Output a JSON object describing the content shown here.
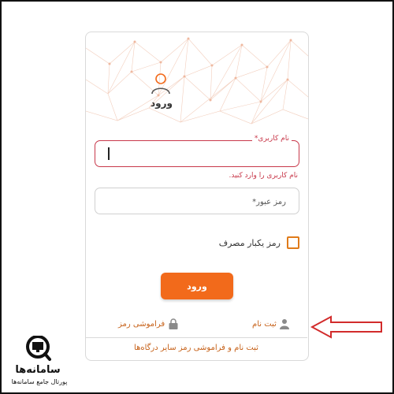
{
  "form": {
    "title": "ورود",
    "username": {
      "label": "نام کاربری",
      "required_mark": "*",
      "value": "",
      "error": "نام کاربری را وارد کنید."
    },
    "password": {
      "placeholder": "رمز عبور",
      "required_mark": "*"
    },
    "otp_checkbox": {
      "label": "رمز یکبار مصرف",
      "checked": false
    },
    "login_button": "ورود",
    "forgot_password": "فراموشی رمز",
    "register": "ثبت نام",
    "other_gateways_link": "ثبت نام و فراموشی رمز سایر درگاه‌ها"
  },
  "branding": {
    "name": "سامانه‌ها",
    "tagline": "پورتال جامع سامانه‌ها"
  },
  "colors": {
    "accent": "#f26a1b",
    "error": "#c8384a",
    "link": "#c7621a",
    "annotation_arrow": "#d22b2b"
  },
  "icons": [
    "user-icon",
    "lock-icon",
    "person-icon",
    "magnifier-monitor-icon"
  ]
}
